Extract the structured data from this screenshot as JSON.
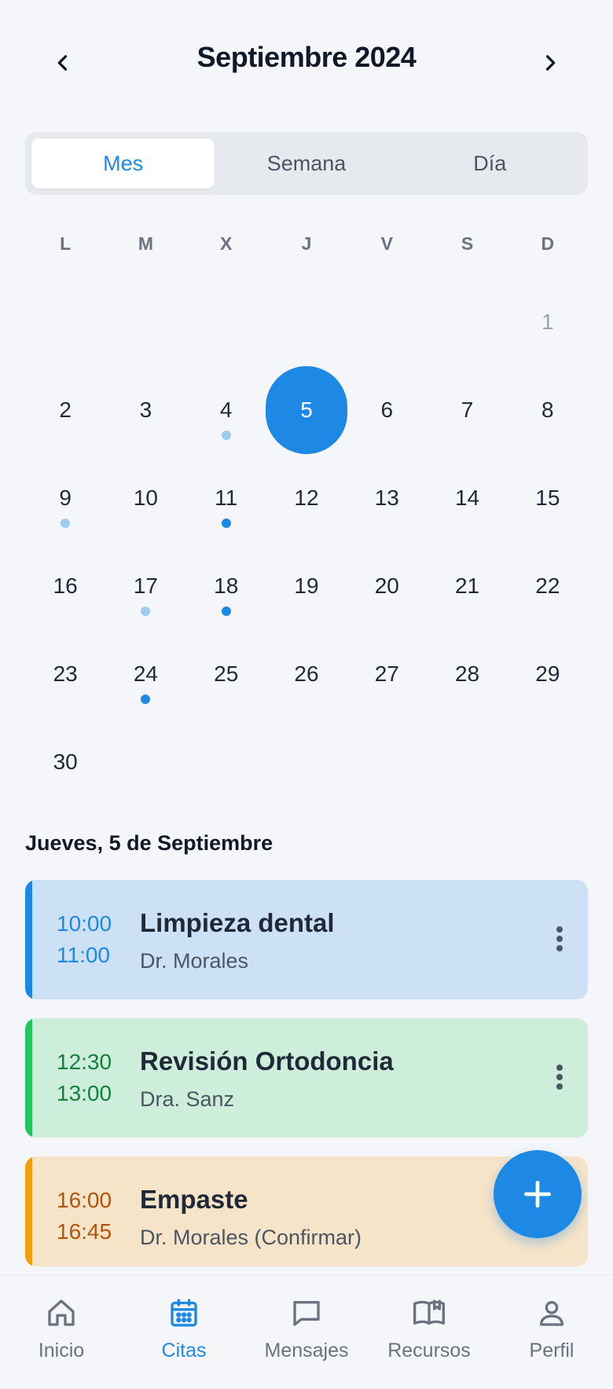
{
  "header": {
    "month_title": "Septiembre 2024",
    "prev_icon": "chevron-left-icon",
    "next_icon": "chevron-right-icon"
  },
  "view_toggle": {
    "tabs": [
      {
        "label": "Mes",
        "active": true
      },
      {
        "label": "Semana",
        "active": false
      },
      {
        "label": "Día",
        "active": false
      }
    ]
  },
  "calendar": {
    "weekdays": [
      "L",
      "M",
      "X",
      "J",
      "V",
      "S",
      "D"
    ],
    "leading_blanks": 6,
    "selected_day": 5,
    "days": [
      {
        "n": "1",
        "muted": true
      },
      {
        "n": "2"
      },
      {
        "n": "3"
      },
      {
        "n": "4",
        "dot": "light"
      },
      {
        "n": "5"
      },
      {
        "n": "6"
      },
      {
        "n": "7"
      },
      {
        "n": "8"
      },
      {
        "n": "9",
        "dot": "light"
      },
      {
        "n": "10"
      },
      {
        "n": "11",
        "dot": "dark"
      },
      {
        "n": "12"
      },
      {
        "n": "13"
      },
      {
        "n": "14"
      },
      {
        "n": "15"
      },
      {
        "n": "16"
      },
      {
        "n": "17",
        "dot": "light"
      },
      {
        "n": "18",
        "dot": "dark"
      },
      {
        "n": "19"
      },
      {
        "n": "20"
      },
      {
        "n": "21"
      },
      {
        "n": "22"
      },
      {
        "n": "23"
      },
      {
        "n": "24",
        "dot": "dark"
      },
      {
        "n": "25"
      },
      {
        "n": "26"
      },
      {
        "n": "27"
      },
      {
        "n": "28"
      },
      {
        "n": "29"
      },
      {
        "n": "30"
      }
    ]
  },
  "agenda": {
    "date_heading": "Jueves, 5 de Septiembre",
    "appointments": [
      {
        "start": "10:00",
        "end": "11:00",
        "title": "Limpieza dental",
        "subtitle": "Dr. Morales",
        "color": "#1e88e5"
      },
      {
        "start": "12:30",
        "end": "13:00",
        "title": "Revisión Ortodoncia",
        "subtitle": "Dra. Sanz",
        "color": "#22c55e"
      },
      {
        "start": "16:00",
        "end": "16:45",
        "title": "Empaste",
        "subtitle": "Dr. Morales (Confirmar)",
        "color": "#f59e0b"
      }
    ]
  },
  "fab": {
    "icon": "plus-icon"
  },
  "bottom_nav": {
    "items": [
      {
        "label": "Inicio",
        "icon": "home-icon",
        "active": false
      },
      {
        "label": "Citas",
        "icon": "calendar-icon",
        "active": true
      },
      {
        "label": "Mensajes",
        "icon": "message-icon",
        "active": false
      },
      {
        "label": "Recursos",
        "icon": "book-icon",
        "active": false
      },
      {
        "label": "Perfil",
        "icon": "user-icon",
        "active": false
      }
    ]
  },
  "colors": {
    "accent": "#1e88e5",
    "background": "#f4f6f9"
  }
}
